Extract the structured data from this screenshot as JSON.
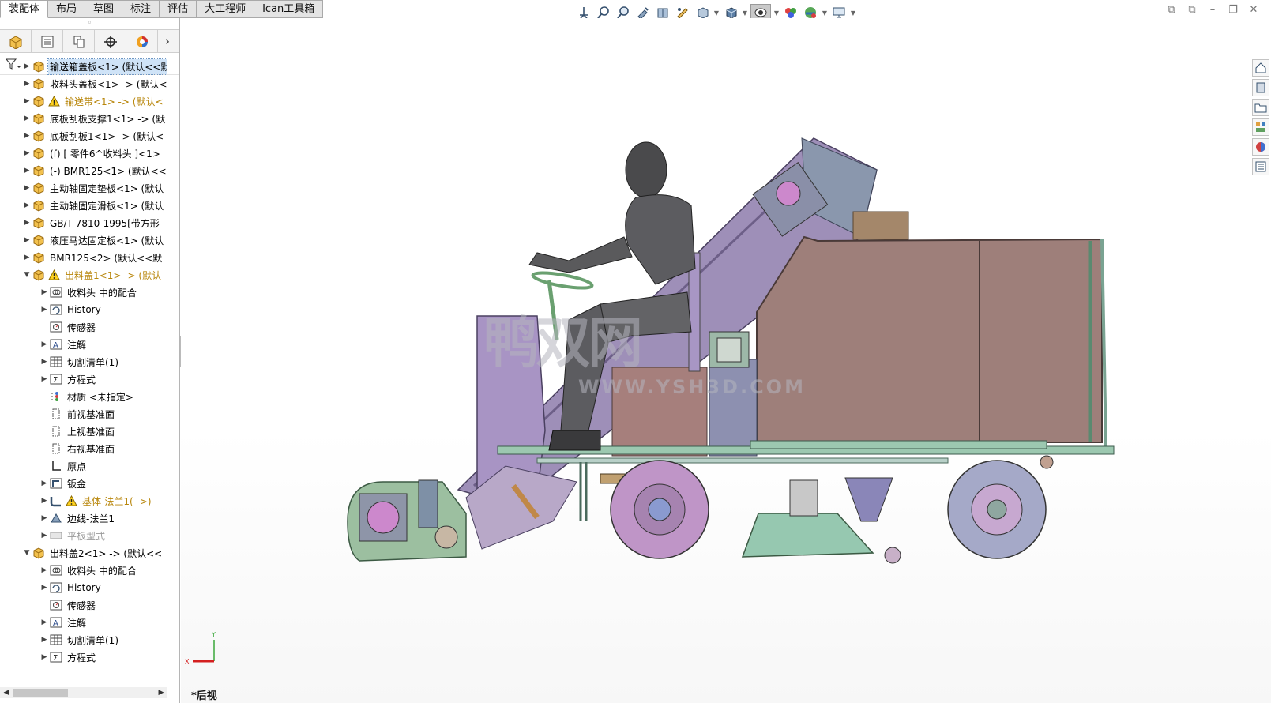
{
  "command_tabs": [
    "装配体",
    "布局",
    "草图",
    "标注",
    "评估",
    "大工程师",
    "Ican工具箱"
  ],
  "view_toolbar": [
    "view-orient-icon",
    "zoom-to-fit-icon",
    "zoom-area-icon",
    "previous-view-icon",
    "section-view-icon",
    "dynamic-annotation-icon",
    "view-orientation-icon",
    "display-style-icon",
    "hide-show-icon",
    "edit-appearance-icon",
    "apply-scene-icon",
    "view-settings-icon"
  ],
  "tree": [
    {
      "arrow": "▶",
      "icon": "part",
      "label": "输送箱盖板<1> (默认<<默",
      "selected": true
    },
    {
      "arrow": "▶",
      "icon": "part",
      "label": "收料头盖板<1> -> (默认<"
    },
    {
      "arrow": "▶",
      "icon": "part",
      "warn": true,
      "label": "输送带<1> -> (默认<",
      "style": "warn"
    },
    {
      "arrow": "▶",
      "icon": "part",
      "label": "底板刮板支撑1<1> -> (默"
    },
    {
      "arrow": "▶",
      "icon": "part",
      "label": "底板刮板1<1> -> (默认<"
    },
    {
      "arrow": "▶",
      "icon": "part",
      "label": "(f) [ 零件6^收料头 ]<1>"
    },
    {
      "arrow": "▶",
      "icon": "part",
      "label": "(-) BMR125<1> (默认<<"
    },
    {
      "arrow": "▶",
      "icon": "part",
      "label": "主动轴固定垫板<1> (默认"
    },
    {
      "arrow": "▶",
      "icon": "part",
      "label": "主动轴固定滑板<1> (默认"
    },
    {
      "arrow": "▶",
      "icon": "part",
      "label": "GB/T 7810-1995[带方形"
    },
    {
      "arrow": "▶",
      "icon": "part",
      "label": "液压马达固定板<1> (默认"
    },
    {
      "arrow": "▶",
      "icon": "part",
      "label": "BMR125<2> (默认<<默"
    },
    {
      "arrow": "▼",
      "icon": "part",
      "warn": true,
      "label": "出料盖1<1> -> (默认",
      "style": "warn"
    },
    {
      "indent": 1,
      "arrow": "▶",
      "icon": "mates",
      "label": "收料头 中的配合"
    },
    {
      "indent": 1,
      "arrow": "▶",
      "icon": "history",
      "label": "History"
    },
    {
      "indent": 1,
      "arrow": "",
      "icon": "sensor",
      "label": "传感器"
    },
    {
      "indent": 1,
      "arrow": "▶",
      "icon": "annotation",
      "label": "注解"
    },
    {
      "indent": 1,
      "arrow": "▶",
      "icon": "cutlist",
      "label": "切割清单(1)"
    },
    {
      "indent": 1,
      "arrow": "▶",
      "icon": "equation",
      "label": "方程式"
    },
    {
      "indent": 1,
      "arrow": "",
      "icon": "material",
      "label": "材质 <未指定>"
    },
    {
      "indent": 1,
      "arrow": "",
      "icon": "plane",
      "label": "前视基准面"
    },
    {
      "indent": 1,
      "arrow": "",
      "icon": "plane",
      "label": "上视基准面"
    },
    {
      "indent": 1,
      "arrow": "",
      "icon": "plane",
      "label": "右视基准面"
    },
    {
      "indent": 1,
      "arrow": "",
      "icon": "origin",
      "label": "原点"
    },
    {
      "indent": 1,
      "arrow": "▶",
      "icon": "sheetmetal",
      "label": "钣金"
    },
    {
      "indent": 1,
      "arrow": "▶",
      "icon": "flange",
      "warn": true,
      "label": "基体-法兰1( ->)",
      "style": "warn"
    },
    {
      "indent": 1,
      "arrow": "▶",
      "icon": "edgeflange",
      "label": "边线-法兰1"
    },
    {
      "indent": 1,
      "arrow": "▶",
      "icon": "flatpattern",
      "label": "平板型式",
      "style": "dim"
    },
    {
      "arrow": "▼",
      "icon": "part",
      "label": "出料盖2<1> -> (默认<<"
    },
    {
      "indent": 1,
      "arrow": "▶",
      "icon": "mates",
      "label": "收料头 中的配合"
    },
    {
      "indent": 1,
      "arrow": "▶",
      "icon": "history",
      "label": "History"
    },
    {
      "indent": 1,
      "arrow": "",
      "icon": "sensor",
      "label": "传感器"
    },
    {
      "indent": 1,
      "arrow": "▶",
      "icon": "annotation",
      "label": "注解"
    },
    {
      "indent": 1,
      "arrow": "▶",
      "icon": "cutlist",
      "label": "切割清单(1)"
    },
    {
      "indent": 1,
      "arrow": "▶",
      "icon": "equation",
      "label": "方程式"
    }
  ],
  "viewport": {
    "view_name": "*后视",
    "watermark_cn": "鸭双网",
    "watermark_url": "WWW.YSH3D.COM",
    "triad": {
      "x_label": "X",
      "y_label": "Y"
    }
  },
  "task_pane": [
    "home-icon",
    "parts-icon",
    "file-explorer-icon",
    "view-palette-icon",
    "appearances-icon",
    "custom-properties-icon"
  ]
}
